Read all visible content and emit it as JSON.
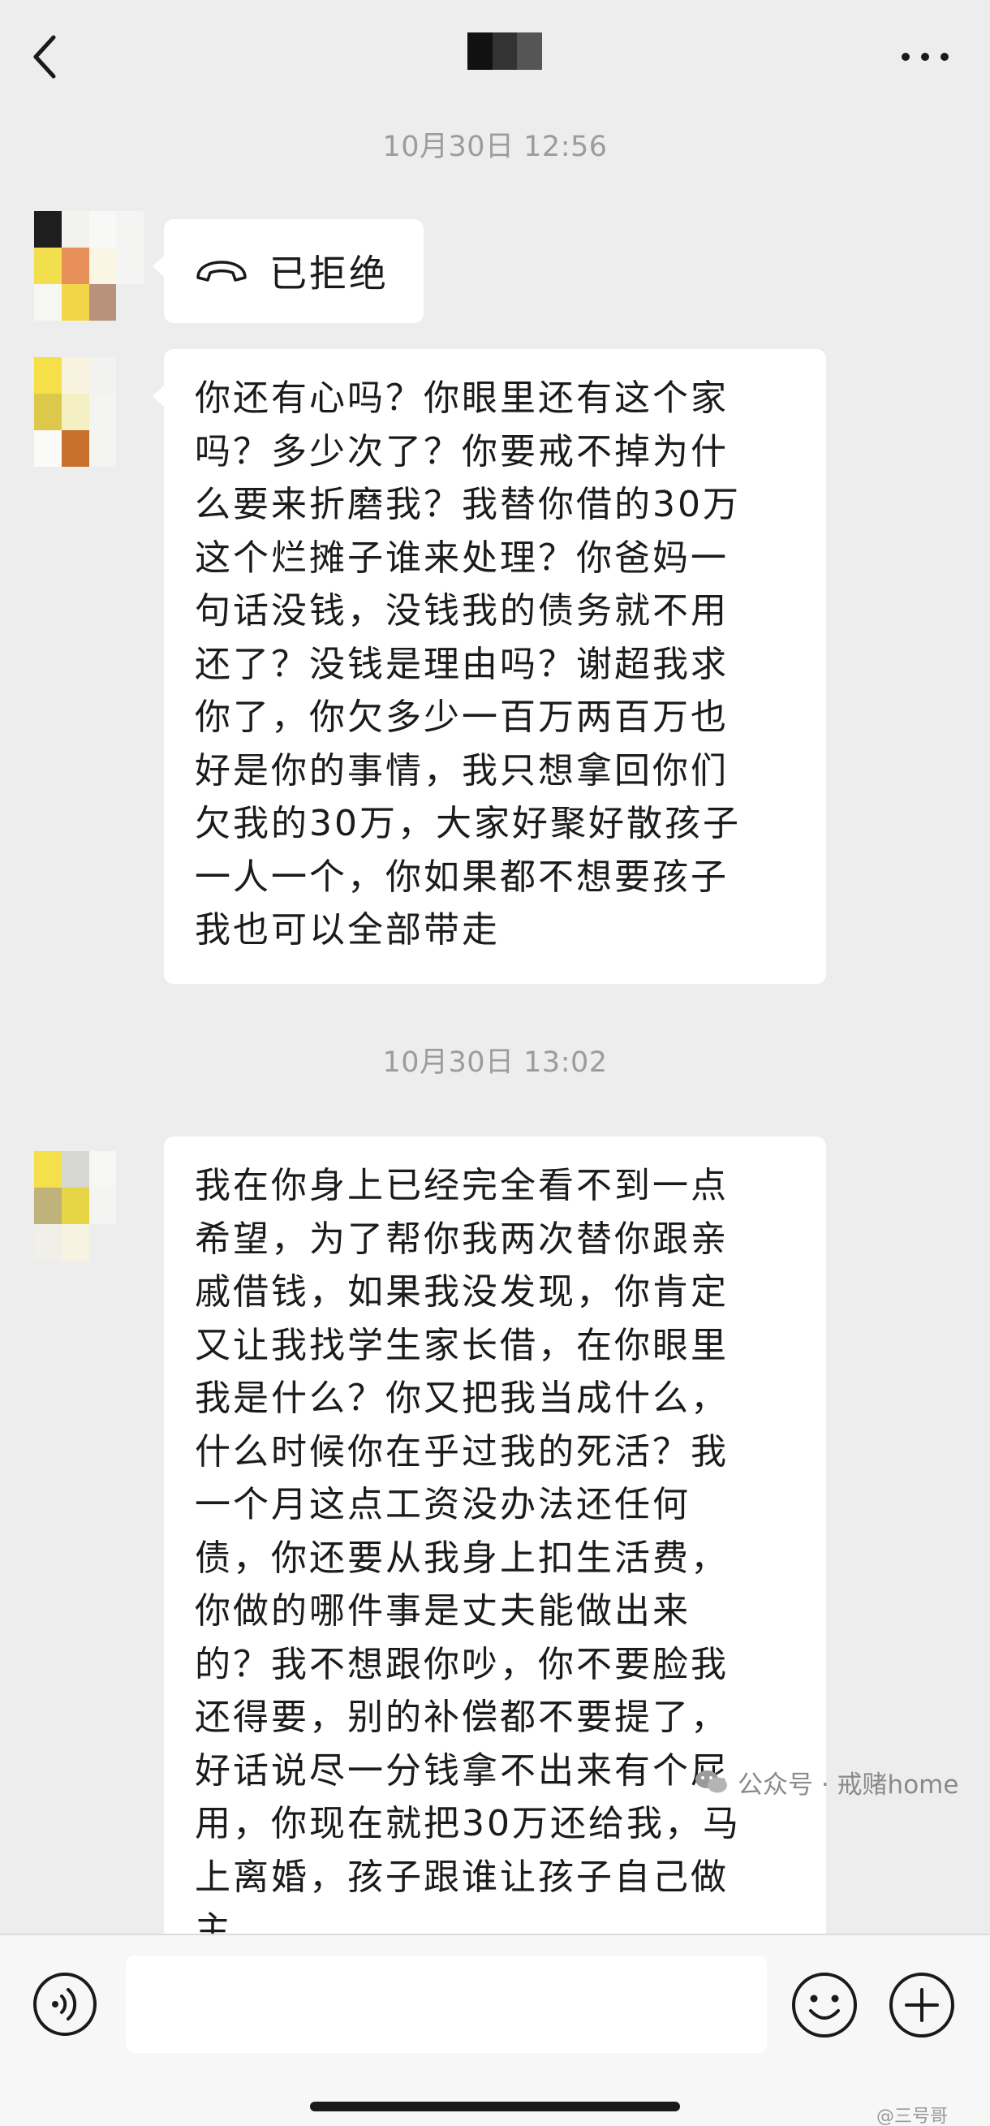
{
  "header": {
    "back_icon": "chevron-left-icon",
    "more_icon": "more-horizontal-icon"
  },
  "timestamps": [
    "10月30日 12:56",
    "10月30日 13:02"
  ],
  "messages": [
    {
      "type": "call",
      "label": "已拒绝",
      "icon": "hangup-phone-icon"
    },
    {
      "type": "text",
      "text": "你还有心吗？你眼里还有这个家\n吗？多少次了？你要戒不掉为什\n么要来折磨我？我替你借的30万\n这个烂摊子谁来处理？你爸妈一\n句话没钱，没钱我的债务就不用\n还了？没钱是理由吗？谢超我求\n你了，你欠多少一百万两百万也\n好是你的事情，我只想拿回你们\n欠我的30万，大家好聚好散孩子\n一人一个，你如果都不想要孩子\n我也可以全部带走"
    },
    {
      "type": "text",
      "text": "我在你身上已经完全看不到一点\n希望，为了帮你我两次替你跟亲\n戚借钱，如果我没发现，你肯定\n又让我找学生家长借，在你眼里\n我是什么？你又把我当成什么，\n什么时候你在乎过我的死活？我\n一个月这点工资没办法还任何\n债，你还要从我身上扣生活费，\n你做的哪件事是丈夫能做出来\n的？我不想跟你吵，你不要脸我\n还得要，别的补偿都不要提了，\n好话说尽一分钱拿不出来有个屁\n用，你现在就把30万还给我，马\n上离婚，孩子跟谁让孩子自己做\n主"
    }
  ],
  "input": {
    "value": "",
    "placeholder": ""
  },
  "toolbar": {
    "voice_icon": "voice-icon",
    "emoji_icon": "emoji-icon",
    "plus_icon": "plus-icon"
  },
  "watermark": {
    "text": "公众号 · 戒赌home",
    "sub": "@三号哥"
  },
  "colors": {
    "background": "#ededed",
    "bubble": "#ffffff",
    "timestamp": "#9c9c9c",
    "toolbar": "#f7f7f7"
  }
}
